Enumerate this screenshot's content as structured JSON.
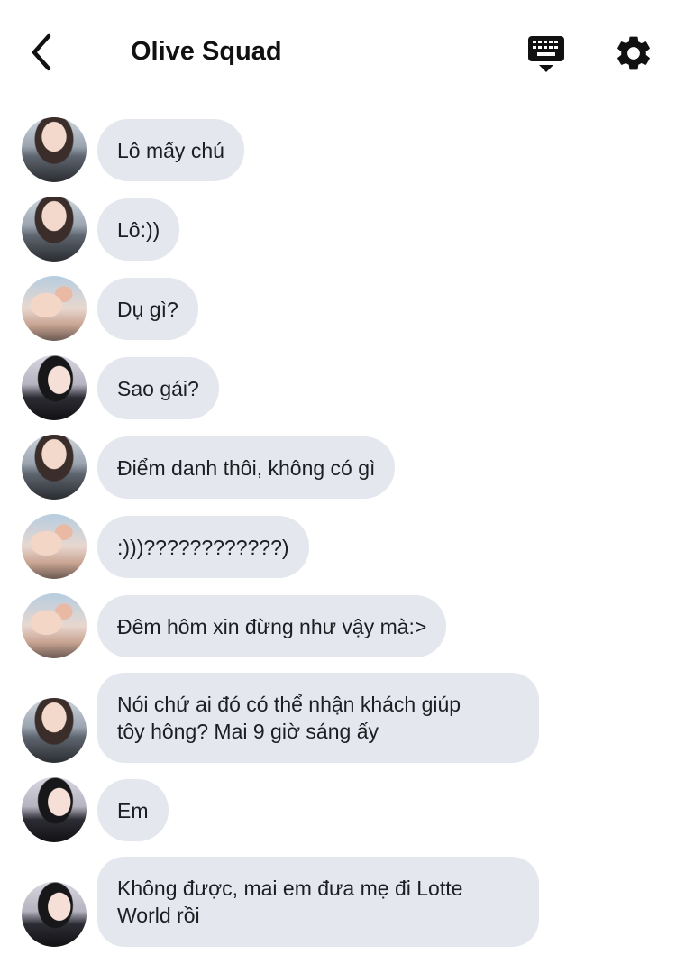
{
  "header": {
    "back_icon": "chevron-left-icon",
    "title": "Olive Squad",
    "keyboard_icon": "keyboard-icon",
    "settings_icon": "gear-icon"
  },
  "messages": [
    {
      "avatar": "user-a",
      "text": "Lô mấy chú"
    },
    {
      "avatar": "user-a",
      "text": "Lô:))"
    },
    {
      "avatar": "user-b",
      "text": "Dụ gì?"
    },
    {
      "avatar": "user-c",
      "text": "Sao gái?"
    },
    {
      "avatar": "user-a",
      "text": "Điểm danh thôi, không có gì"
    },
    {
      "avatar": "user-b",
      "text": ":)))????????????)"
    },
    {
      "avatar": "user-b",
      "text": "Đêm hôm xin đừng như vậy mà:>"
    },
    {
      "avatar": "user-a",
      "text": "Nói chứ ai đó có thể nhận khách giúp\ntôy hông? Mai 9 giờ sáng ấy"
    },
    {
      "avatar": "user-c",
      "text": "Em"
    },
    {
      "avatar": "user-c",
      "text": "Không được, mai em đưa mẹ đi Lotte\nWorld rồi"
    }
  ],
  "colors": {
    "bubble_bg": "#e4e8ee",
    "text": "#1c1e21",
    "background": "#ffffff"
  }
}
